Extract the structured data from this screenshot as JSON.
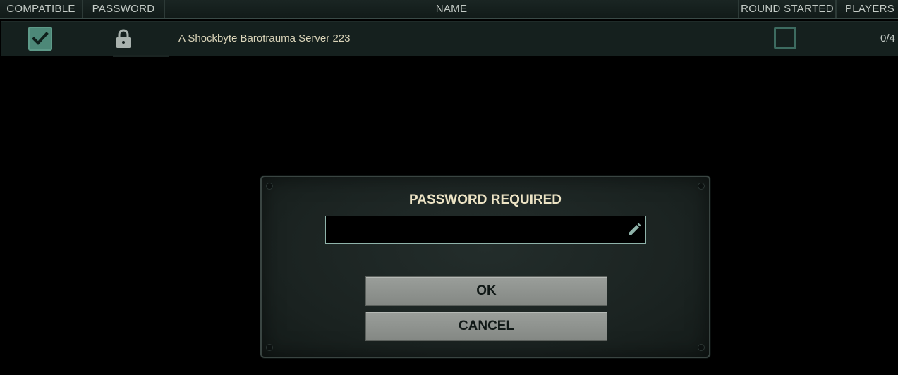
{
  "columns": {
    "compatible": "COMPATIBLE",
    "password": "PASSWORD",
    "name": "NAME",
    "round_started": "ROUND STARTED",
    "players": "PLAYERS"
  },
  "server_row": {
    "compatible": true,
    "password_protected": true,
    "name": "A Shockbyte Barotrauma Server 223",
    "round_started": false,
    "players": "0/4"
  },
  "dialog": {
    "title": "PASSWORD REQUIRED",
    "password_value": "",
    "ok_label": "OK",
    "cancel_label": "CANCEL"
  },
  "icons": {
    "check": "check-icon",
    "lock": "lock-icon",
    "pencil": "pencil-icon"
  },
  "colors": {
    "accent": "#4d8878",
    "title_text": "#ece3c4",
    "button_bg": "#8f938f"
  }
}
